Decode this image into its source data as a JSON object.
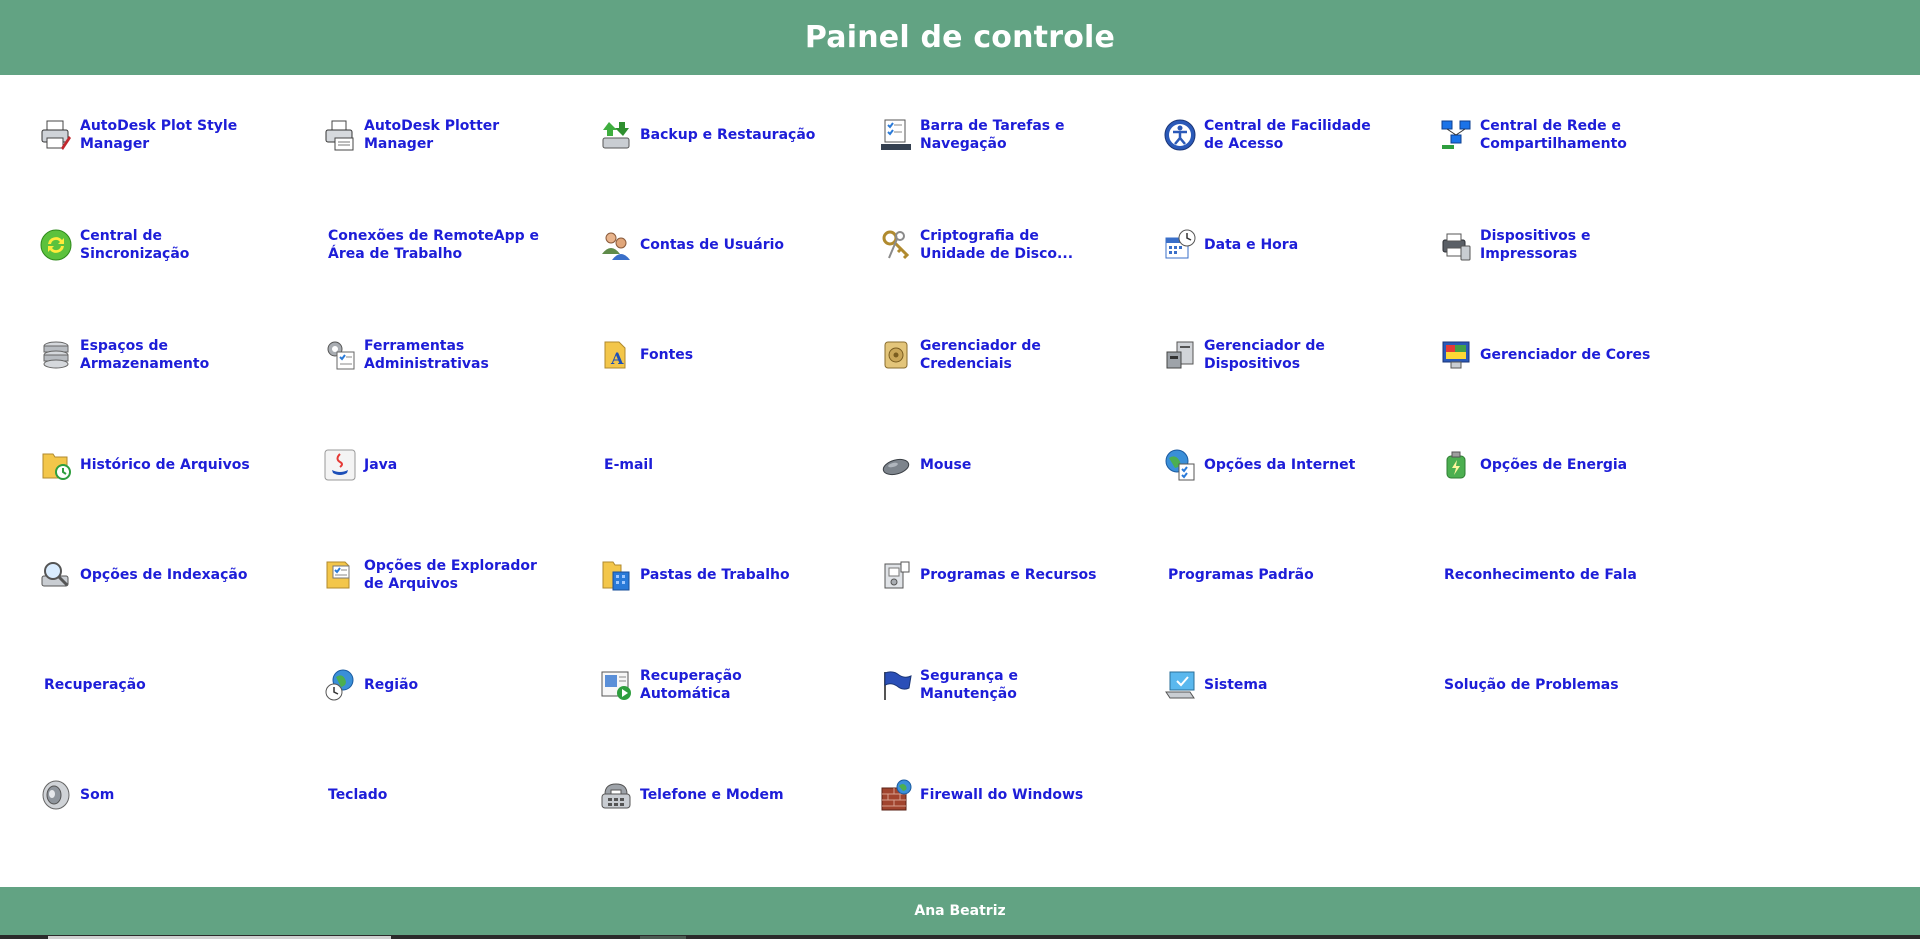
{
  "header": {
    "title": "Painel de controle"
  },
  "footer": {
    "user_name": "Ana Beatriz"
  },
  "items": [
    {
      "label": "AutoDesk Plot Style\nManager",
      "icon": "printer-pen-icon"
    },
    {
      "label": "AutoDesk Plotter\nManager",
      "icon": "plotter-icon"
    },
    {
      "label": "Backup e Restauração",
      "icon": "backup-icon"
    },
    {
      "label": "Barra de Tarefas e\nNavegação",
      "icon": "taskbar-icon"
    },
    {
      "label": "Central de Facilidade\nde Acesso",
      "icon": "accessibility-icon"
    },
    {
      "label": "Central de Rede e\nCompartilhamento",
      "icon": "network-icon"
    },
    {
      "label": "Central de\nSincronização",
      "icon": "sync-icon"
    },
    {
      "label": "Conexões de RemoteApp e\nÁrea de Trabalho",
      "icon": ""
    },
    {
      "label": "Contas de Usuário",
      "icon": "users-icon"
    },
    {
      "label": "Criptografia de\nUnidade de Disco...",
      "icon": "keys-icon"
    },
    {
      "label": "Data e Hora",
      "icon": "calendar-clock-icon"
    },
    {
      "label": "Dispositivos e\nImpressoras",
      "icon": "devices-printer-icon"
    },
    {
      "label": "Espaços de\nArmazenamento",
      "icon": "storage-icon"
    },
    {
      "label": "Ferramentas\nAdministrativas",
      "icon": "admin-tools-icon"
    },
    {
      "label": "Fontes",
      "icon": "fonts-icon"
    },
    {
      "label": "Gerenciador de\nCredenciais",
      "icon": "credential-vault-icon"
    },
    {
      "label": "Gerenciador de\nDispositivos",
      "icon": "device-manager-icon"
    },
    {
      "label": "Gerenciador de Cores",
      "icon": "color-management-icon"
    },
    {
      "label": "Histórico de Arquivos",
      "icon": "file-history-icon"
    },
    {
      "label": "Java",
      "icon": "java-icon"
    },
    {
      "label": "E-mail",
      "icon": ""
    },
    {
      "label": "Mouse",
      "icon": "mouse-icon"
    },
    {
      "label": "Opções da Internet",
      "icon": "internet-options-icon"
    },
    {
      "label": "Opções de Energia",
      "icon": "power-options-icon"
    },
    {
      "label": "Opções de Indexação",
      "icon": "indexing-icon"
    },
    {
      "label": "Opções de Explorador\nde Arquivos",
      "icon": "folder-options-icon"
    },
    {
      "label": "Pastas de Trabalho",
      "icon": "work-folders-icon"
    },
    {
      "label": "Programas e Recursos",
      "icon": "programs-icon"
    },
    {
      "label": "Programas Padrão",
      "icon": ""
    },
    {
      "label": "Reconhecimento de Fala",
      "icon": ""
    },
    {
      "label": "Recuperação",
      "icon": ""
    },
    {
      "label": "Região",
      "icon": "region-icon"
    },
    {
      "label": "Recuperação\nAutomática",
      "icon": "autoplay-icon"
    },
    {
      "label": "Segurança e\nManutenção",
      "icon": "security-flag-icon"
    },
    {
      "label": "Sistema",
      "icon": "system-icon"
    },
    {
      "label": "Solução de Problemas",
      "icon": ""
    },
    {
      "label": "Som",
      "icon": "sound-icon"
    },
    {
      "label": "Teclado",
      "icon": ""
    },
    {
      "label": "Telefone e Modem",
      "icon": "phone-modem-icon"
    },
    {
      "label": "Firewall do Windows",
      "icon": "firewall-icon"
    }
  ]
}
